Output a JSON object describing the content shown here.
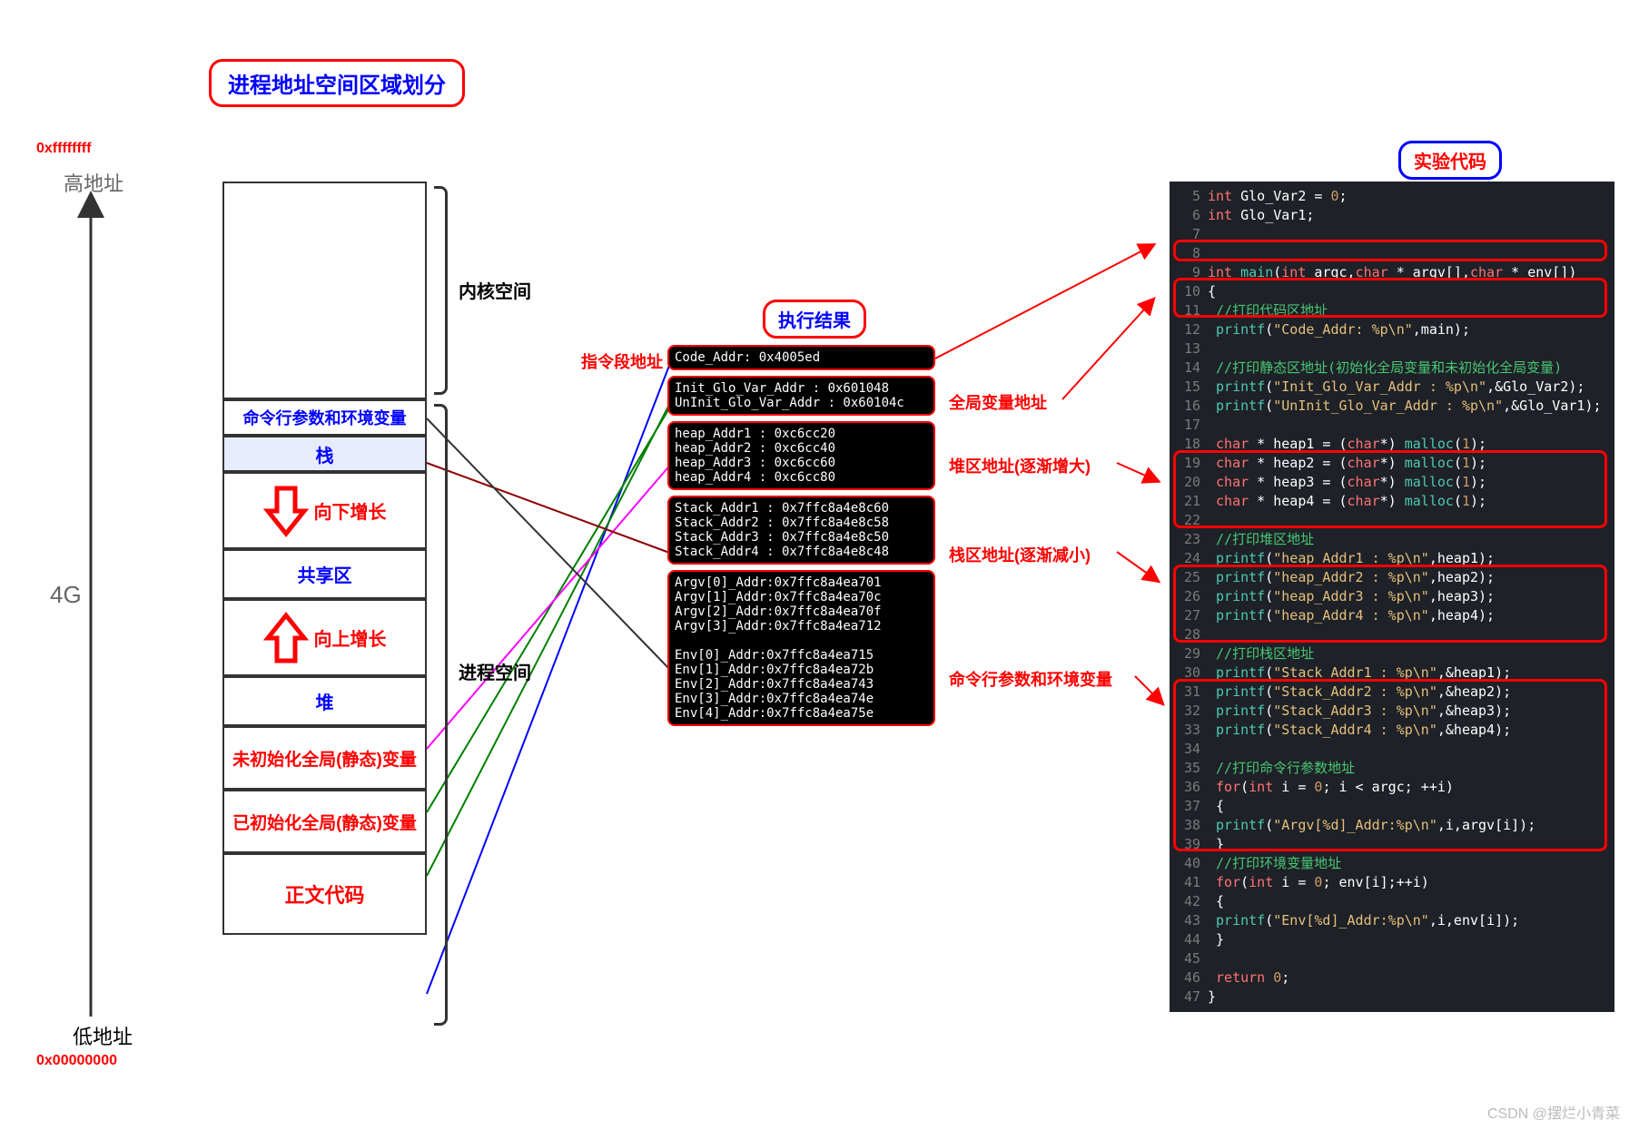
{
  "titles": {
    "main": "进程地址空间区域划分",
    "result": "执行结果",
    "code": "实验代码"
  },
  "addresses": {
    "high_hex": "0xffffffff",
    "high_label": "高地址",
    "low_label": "低地址",
    "low_hex": "0x00000000",
    "size_label": "4G"
  },
  "memory": {
    "kernel": "内核空间",
    "args_env": "命令行参数和环境变量",
    "stack": "栈",
    "grow_down": "向下增长",
    "shared": "共享区",
    "grow_up": "向上增长",
    "heap": "堆",
    "bss": "未初始化全局(静态)变量",
    "data": "已初始化全局(静态)变量",
    "text": "正文代码",
    "process_space": "进程空间"
  },
  "labels": {
    "code_ptr": "指令段地址",
    "global_addr": "全局变量地址",
    "heap_addr": "堆区地址(逐渐增大)",
    "stack_addr": "栈区地址(逐渐减小)",
    "args_addr": "命令行参数和环境变量"
  },
  "terminal": {
    "code": [
      "Code_Addr: 0x4005ed"
    ],
    "global": [
      "Init_Glo_Var_Addr : 0x601048",
      "UnInit_Glo_Var_Addr : 0x60104c"
    ],
    "heap": [
      "heap_Addr1 : 0xc6cc20",
      "heap_Addr2 : 0xc6cc40",
      "heap_Addr3 : 0xc6cc60",
      "heap_Addr4 : 0xc6cc80"
    ],
    "stack": [
      "Stack_Addr1 : 0x7ffc8a4e8c60",
      "Stack_Addr2 : 0x7ffc8a4e8c58",
      "Stack_Addr3 : 0x7ffc8a4e8c50",
      "Stack_Addr4 : 0x7ffc8a4e8c48"
    ],
    "argv": [
      "Argv[0]_Addr:0x7ffc8a4ea701",
      "Argv[1]_Addr:0x7ffc8a4ea70c",
      "Argv[2]_Addr:0x7ffc8a4ea70f",
      "Argv[3]_Addr:0x7ffc8a4ea712"
    ],
    "env": [
      "Env[0]_Addr:0x7ffc8a4ea715",
      "Env[1]_Addr:0x7ffc8a4ea72b",
      "Env[2]_Addr:0x7ffc8a4ea743",
      "Env[3]_Addr:0x7ffc8a4ea74e",
      "Env[4]_Addr:0x7ffc8a4ea75e"
    ]
  },
  "code_lines": [
    {
      "n": 5,
      "tokens": [
        {
          "c": "ty",
          "t": "int"
        },
        {
          "t": " Glo_Var2 = "
        },
        {
          "c": "num",
          "t": "0"
        },
        {
          "t": ";"
        }
      ]
    },
    {
      "n": 6,
      "tokens": [
        {
          "c": "ty",
          "t": "int"
        },
        {
          "t": " Glo_Var1;"
        }
      ]
    },
    {
      "n": 7,
      "tokens": []
    },
    {
      "n": 8,
      "tokens": []
    },
    {
      "n": 9,
      "tokens": [
        {
          "c": "ty",
          "t": "int"
        },
        {
          "t": " "
        },
        {
          "c": "fn",
          "t": "main"
        },
        {
          "t": "("
        },
        {
          "c": "ty",
          "t": "int"
        },
        {
          "t": " argc,"
        },
        {
          "c": "ty",
          "t": "char"
        },
        {
          "t": " * argv[],"
        },
        {
          "c": "ty",
          "t": "char"
        },
        {
          "t": " * env[])"
        }
      ]
    },
    {
      "n": 10,
      "tokens": [
        {
          "t": "{"
        }
      ]
    },
    {
      "n": 11,
      "tokens": [
        {
          "t": "  "
        },
        {
          "c": "cm",
          "t": "//打印代码区地址"
        }
      ]
    },
    {
      "n": 12,
      "tokens": [
        {
          "t": "  "
        },
        {
          "c": "fn",
          "t": "printf"
        },
        {
          "t": "("
        },
        {
          "c": "str",
          "t": "\"Code_Addr: %p\\n\""
        },
        {
          "t": ",main);"
        }
      ]
    },
    {
      "n": 13,
      "tokens": []
    },
    {
      "n": 14,
      "tokens": [
        {
          "t": "  "
        },
        {
          "c": "cm",
          "t": "//打印静态区地址(初始化全局变量和未初始化全局变量)"
        }
      ]
    },
    {
      "n": 15,
      "tokens": [
        {
          "t": "  "
        },
        {
          "c": "fn",
          "t": "printf"
        },
        {
          "t": "("
        },
        {
          "c": "str",
          "t": "\"Init_Glo_Var_Addr : %p\\n\""
        },
        {
          "t": ",&Glo_Var2);"
        }
      ]
    },
    {
      "n": 16,
      "tokens": [
        {
          "t": "  "
        },
        {
          "c": "fn",
          "t": "printf"
        },
        {
          "t": "("
        },
        {
          "c": "str",
          "t": "\"UnInit_Glo_Var_Addr : %p\\n\""
        },
        {
          "t": ",&Glo_Var1);"
        }
      ]
    },
    {
      "n": 17,
      "tokens": []
    },
    {
      "n": 18,
      "tokens": [
        {
          "t": "  "
        },
        {
          "c": "ty",
          "t": "char"
        },
        {
          "t": " * heap1 = ("
        },
        {
          "c": "ty",
          "t": "char"
        },
        {
          "t": "*) "
        },
        {
          "c": "fn",
          "t": "malloc"
        },
        {
          "t": "("
        },
        {
          "c": "num",
          "t": "1"
        },
        {
          "t": ");"
        }
      ]
    },
    {
      "n": 19,
      "tokens": [
        {
          "t": "  "
        },
        {
          "c": "ty",
          "t": "char"
        },
        {
          "t": " * heap2 = ("
        },
        {
          "c": "ty",
          "t": "char"
        },
        {
          "t": "*) "
        },
        {
          "c": "fn",
          "t": "malloc"
        },
        {
          "t": "("
        },
        {
          "c": "num",
          "t": "1"
        },
        {
          "t": ");"
        }
      ]
    },
    {
      "n": 20,
      "tokens": [
        {
          "t": "  "
        },
        {
          "c": "ty",
          "t": "char"
        },
        {
          "t": " * heap3 = ("
        },
        {
          "c": "ty",
          "t": "char"
        },
        {
          "t": "*) "
        },
        {
          "c": "fn",
          "t": "malloc"
        },
        {
          "t": "("
        },
        {
          "c": "num",
          "t": "1"
        },
        {
          "t": ");"
        }
      ]
    },
    {
      "n": 21,
      "tokens": [
        {
          "t": "  "
        },
        {
          "c": "ty",
          "t": "char"
        },
        {
          "t": " * heap4 = ("
        },
        {
          "c": "ty",
          "t": "char"
        },
        {
          "t": "*) "
        },
        {
          "c": "fn",
          "t": "malloc"
        },
        {
          "t": "("
        },
        {
          "c": "num",
          "t": "1"
        },
        {
          "t": ");"
        }
      ]
    },
    {
      "n": 22,
      "tokens": []
    },
    {
      "n": 23,
      "tokens": [
        {
          "t": "  "
        },
        {
          "c": "cm",
          "t": "//打印堆区地址"
        }
      ]
    },
    {
      "n": 24,
      "tokens": [
        {
          "t": "  "
        },
        {
          "c": "fn",
          "t": "printf"
        },
        {
          "t": "("
        },
        {
          "c": "str",
          "t": "\"heap_Addr1 : %p\\n\""
        },
        {
          "t": ",heap1);"
        }
      ]
    },
    {
      "n": 25,
      "tokens": [
        {
          "t": "  "
        },
        {
          "c": "fn",
          "t": "printf"
        },
        {
          "t": "("
        },
        {
          "c": "str",
          "t": "\"heap_Addr2 : %p\\n\""
        },
        {
          "t": ",heap2);"
        }
      ]
    },
    {
      "n": 26,
      "tokens": [
        {
          "t": "  "
        },
        {
          "c": "fn",
          "t": "printf"
        },
        {
          "t": "("
        },
        {
          "c": "str",
          "t": "\"heap_Addr3 : %p\\n\""
        },
        {
          "t": ",heap3);"
        }
      ]
    },
    {
      "n": 27,
      "tokens": [
        {
          "t": "  "
        },
        {
          "c": "fn",
          "t": "printf"
        },
        {
          "t": "("
        },
        {
          "c": "str",
          "t": "\"heap_Addr4 : %p\\n\""
        },
        {
          "t": ",heap4);"
        }
      ]
    },
    {
      "n": 28,
      "tokens": []
    },
    {
      "n": 29,
      "tokens": [
        {
          "t": "  "
        },
        {
          "c": "cm",
          "t": "//打印栈区地址"
        }
      ]
    },
    {
      "n": 30,
      "tokens": [
        {
          "t": "  "
        },
        {
          "c": "fn",
          "t": "printf"
        },
        {
          "t": "("
        },
        {
          "c": "str",
          "t": "\"Stack_Addr1 : %p\\n\""
        },
        {
          "t": ",&heap1);"
        }
      ]
    },
    {
      "n": 31,
      "tokens": [
        {
          "t": "  "
        },
        {
          "c": "fn",
          "t": "printf"
        },
        {
          "t": "("
        },
        {
          "c": "str",
          "t": "\"Stack_Addr2 : %p\\n\""
        },
        {
          "t": ",&heap2);"
        }
      ]
    },
    {
      "n": 32,
      "tokens": [
        {
          "t": "  "
        },
        {
          "c": "fn",
          "t": "printf"
        },
        {
          "t": "("
        },
        {
          "c": "str",
          "t": "\"Stack_Addr3 : %p\\n\""
        },
        {
          "t": ",&heap3);"
        }
      ]
    },
    {
      "n": 33,
      "tokens": [
        {
          "t": "  "
        },
        {
          "c": "fn",
          "t": "printf"
        },
        {
          "t": "("
        },
        {
          "c": "str",
          "t": "\"Stack_Addr4 : %p\\n\""
        },
        {
          "t": ",&heap4);"
        }
      ]
    },
    {
      "n": 34,
      "tokens": []
    },
    {
      "n": 35,
      "tokens": [
        {
          "t": "  "
        },
        {
          "c": "cm",
          "t": "//打印命令行参数地址"
        }
      ]
    },
    {
      "n": 36,
      "tokens": [
        {
          "t": "  "
        },
        {
          "c": "kw",
          "t": "for"
        },
        {
          "t": "("
        },
        {
          "c": "ty",
          "t": "int"
        },
        {
          "t": " i = "
        },
        {
          "c": "num",
          "t": "0"
        },
        {
          "t": "; i < argc; ++i)"
        }
      ]
    },
    {
      "n": 37,
      "tokens": [
        {
          "t": "  {"
        }
      ]
    },
    {
      "n": 38,
      "tokens": [
        {
          "t": "    "
        },
        {
          "c": "fn",
          "t": "printf"
        },
        {
          "t": "("
        },
        {
          "c": "str",
          "t": "\"Argv[%d]_Addr:%p\\n\""
        },
        {
          "t": ",i,argv[i]);"
        }
      ]
    },
    {
      "n": 39,
      "tokens": [
        {
          "t": "  }"
        }
      ]
    },
    {
      "n": 40,
      "tokens": [
        {
          "t": "  "
        },
        {
          "c": "cm",
          "t": "//打印环境变量地址"
        }
      ]
    },
    {
      "n": 41,
      "tokens": [
        {
          "t": "  "
        },
        {
          "c": "kw",
          "t": "for"
        },
        {
          "t": "("
        },
        {
          "c": "ty",
          "t": "int"
        },
        {
          "t": " i = "
        },
        {
          "c": "num",
          "t": "0"
        },
        {
          "t": "; env[i];++i)"
        }
      ]
    },
    {
      "n": 42,
      "tokens": [
        {
          "t": "  {"
        }
      ]
    },
    {
      "n": 43,
      "tokens": [
        {
          "t": "    "
        },
        {
          "c": "fn",
          "t": "printf"
        },
        {
          "t": "("
        },
        {
          "c": "str",
          "t": "\"Env[%d]_Addr:%p\\n\""
        },
        {
          "t": ",i,env[i]);"
        }
      ]
    },
    {
      "n": 44,
      "tokens": [
        {
          "t": "  }"
        }
      ]
    },
    {
      "n": 45,
      "tokens": []
    },
    {
      "n": 46,
      "tokens": [
        {
          "t": "  "
        },
        {
          "c": "kw",
          "t": "return"
        },
        {
          "t": " "
        },
        {
          "c": "num",
          "t": "0"
        },
        {
          "t": ";"
        }
      ]
    },
    {
      "n": 47,
      "tokens": [
        {
          "t": "}"
        }
      ]
    }
  ],
  "watermark": "CSDN @摆烂小青菜"
}
